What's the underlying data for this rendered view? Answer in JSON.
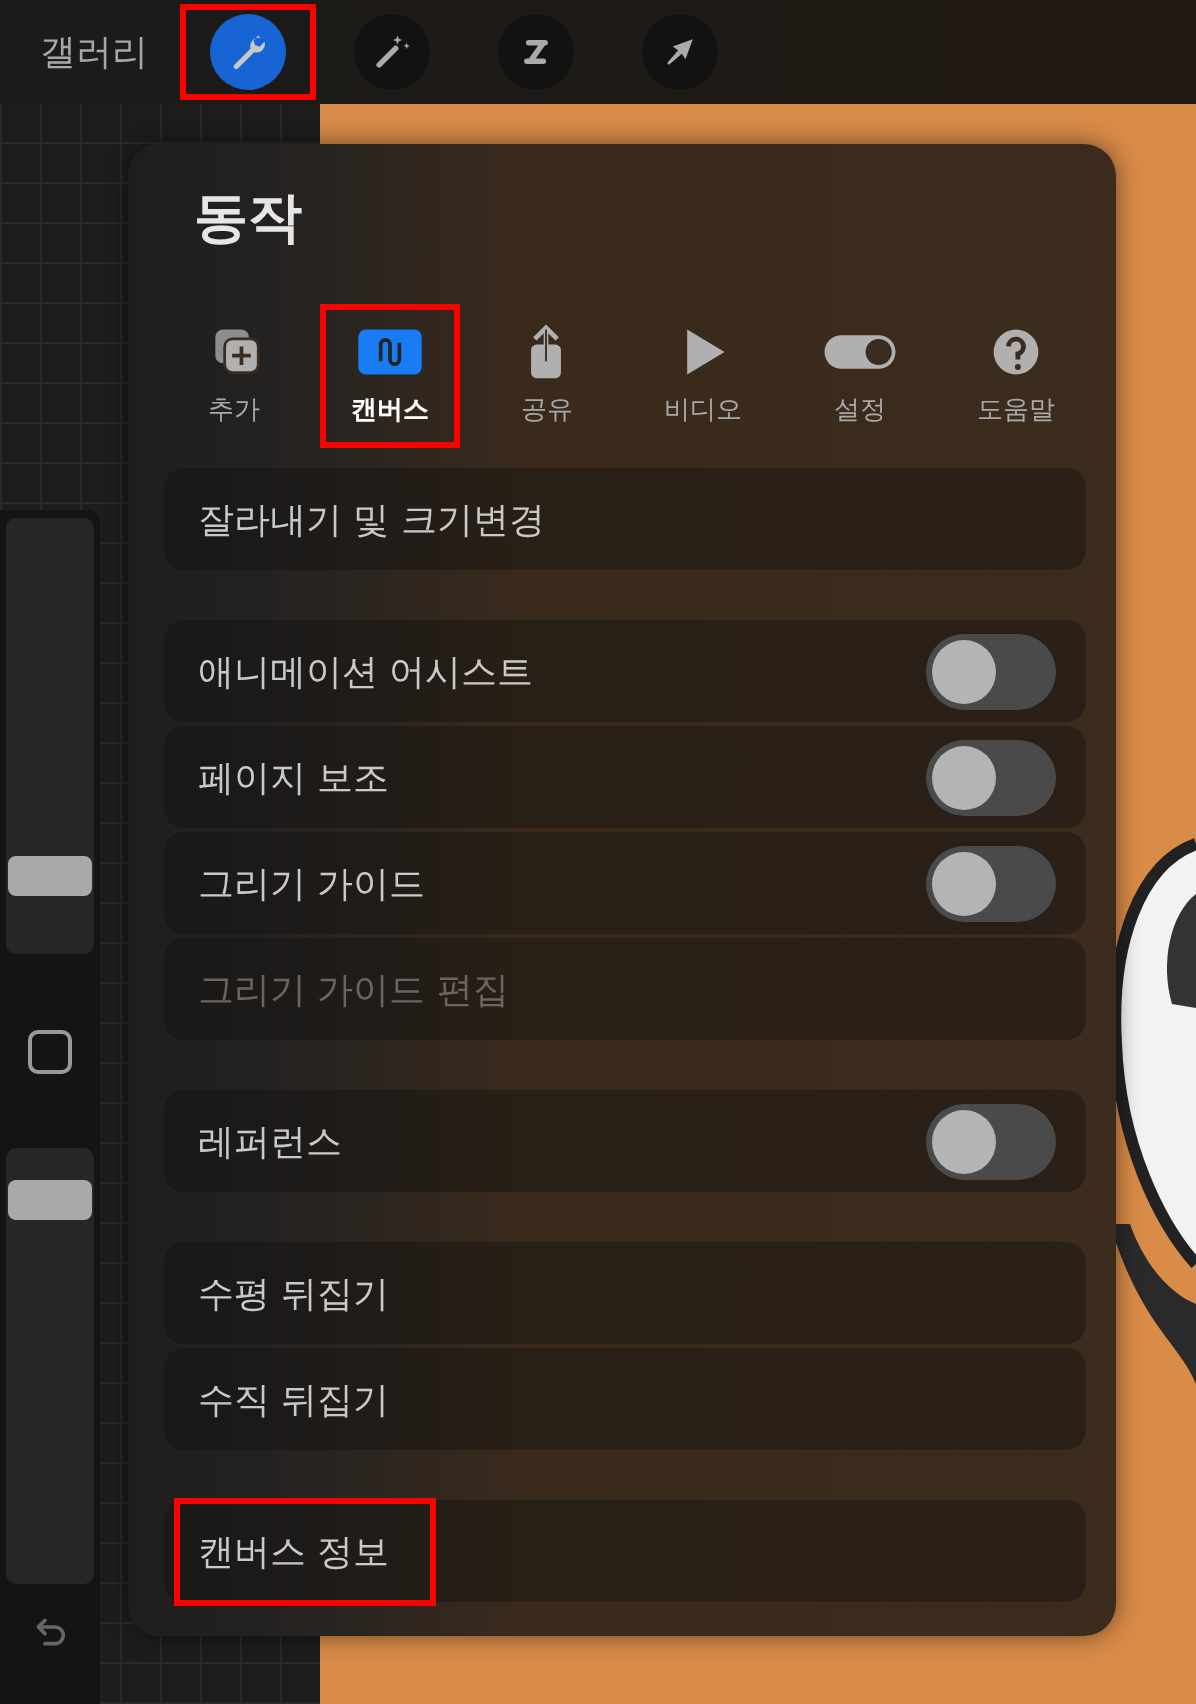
{
  "top_bar": {
    "gallery": "갤러리",
    "tools": [
      {
        "kind": "wrench",
        "selected": true,
        "highlighted": true
      },
      {
        "kind": "wand",
        "selected": false,
        "highlighted": false
      },
      {
        "kind": "smudge",
        "selected": false,
        "highlighted": false
      },
      {
        "kind": "arrow",
        "selected": false,
        "highlighted": false
      }
    ]
  },
  "sidebar": {
    "sliders": [
      {
        "level": 0.15
      },
      {
        "level": 0.93
      }
    ]
  },
  "actions_panel": {
    "title": "동작",
    "tabs": [
      {
        "kind": "add",
        "label": "추가",
        "selected": false,
        "highlighted": false
      },
      {
        "kind": "canvas",
        "label": "캔버스",
        "selected": true,
        "highlighted": true
      },
      {
        "kind": "share",
        "label": "공유",
        "selected": false,
        "highlighted": false
      },
      {
        "kind": "video",
        "label": "비디오",
        "selected": false,
        "highlighted": false
      },
      {
        "kind": "prefs",
        "label": "설정",
        "selected": false,
        "highlighted": false
      },
      {
        "kind": "help",
        "label": "도움말",
        "selected": false,
        "highlighted": false
      }
    ],
    "groups": [
      [
        {
          "kind": "plain",
          "label": "잘라내기 및 크기변경",
          "disabled": false,
          "highlighted": false
        }
      ],
      [
        {
          "kind": "toggle",
          "label": "애니메이션 어시스트",
          "on": false,
          "disabled": false,
          "highlighted": false
        },
        {
          "kind": "toggle",
          "label": "페이지 보조",
          "on": false,
          "disabled": false,
          "highlighted": false
        },
        {
          "kind": "toggle",
          "label": "그리기 가이드",
          "on": false,
          "disabled": false,
          "highlighted": false
        },
        {
          "kind": "plain",
          "label": "그리기 가이드 편집",
          "disabled": true,
          "highlighted": false
        }
      ],
      [
        {
          "kind": "toggle",
          "label": "레퍼런스",
          "on": false,
          "disabled": false,
          "highlighted": false
        }
      ],
      [
        {
          "kind": "plain",
          "label": "수평 뒤집기",
          "disabled": false,
          "highlighted": false
        },
        {
          "kind": "plain",
          "label": "수직 뒤집기",
          "disabled": false,
          "highlighted": false
        }
      ],
      [
        {
          "kind": "plain",
          "label": "캔버스 정보",
          "disabled": false,
          "highlighted": true
        }
      ]
    ]
  }
}
